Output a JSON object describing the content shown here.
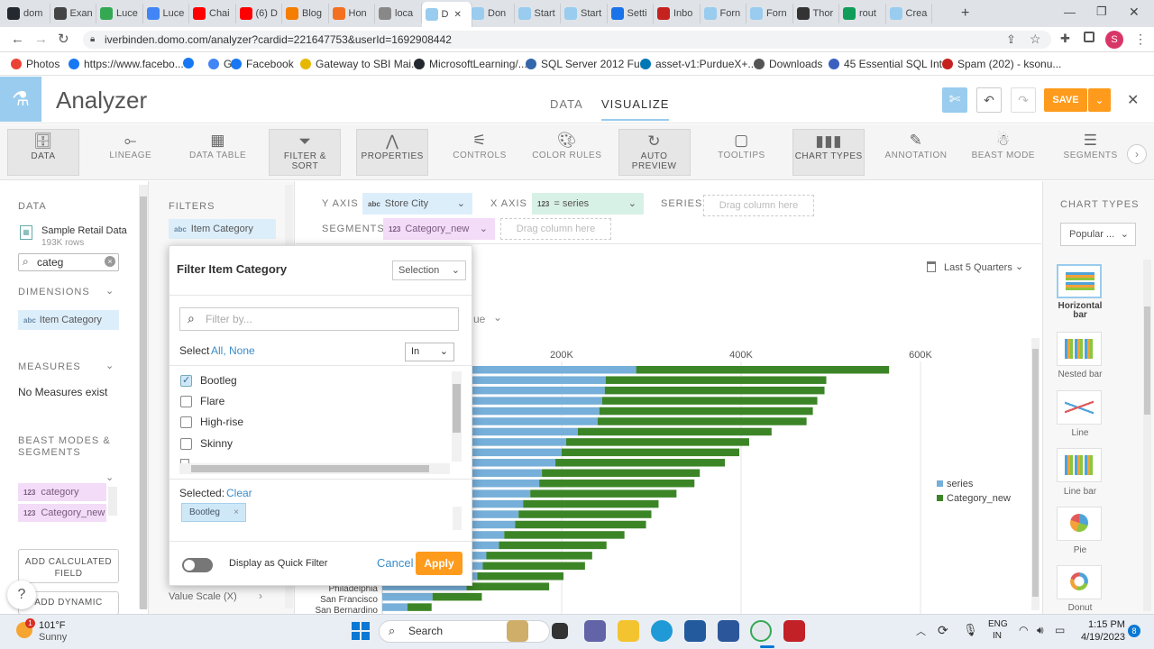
{
  "browser": {
    "tabs": [
      {
        "label": "dom",
        "color": "#24292f"
      },
      {
        "label": "Exan",
        "color": "#444"
      },
      {
        "label": "Luce",
        "color": "#34a853"
      },
      {
        "label": "Luce",
        "color": "#4285f4"
      },
      {
        "label": "Chai",
        "color": "#ff0000"
      },
      {
        "label": "(6) D",
        "color": "#ff0000"
      },
      {
        "label": "Blog",
        "color": "#f57d00"
      },
      {
        "label": "Hon",
        "color": "#f37021"
      },
      {
        "label": "loca",
        "color": "#888"
      },
      {
        "label": "D",
        "color": "#99ccee"
      },
      {
        "label": "Don",
        "color": "#99ccee"
      },
      {
        "label": "Start",
        "color": "#99ccee"
      },
      {
        "label": "Start",
        "color": "#99ccee"
      },
      {
        "label": "Setti",
        "color": "#1a73e8"
      },
      {
        "label": "Inbo",
        "color": "#c5221f"
      },
      {
        "label": "Forn",
        "color": "#99ccee"
      },
      {
        "label": "Forn",
        "color": "#99ccee"
      },
      {
        "label": "Thor",
        "color": "#333"
      },
      {
        "label": "rout",
        "color": "#0f9d58"
      },
      {
        "label": "Crea",
        "color": "#99ccee"
      }
    ],
    "url": "iverbinden.domo.com/analyzer?cardid=221647753&userId=1692908442",
    "bookmarks": [
      {
        "label": "Photos",
        "color": "#ea4335"
      },
      {
        "label": "https://www.facebo...",
        "color": "#1877f2"
      },
      {
        "label": "",
        "color": "#1877f2"
      },
      {
        "label": "G",
        "color": "#4285f4"
      },
      {
        "label": "Facebook",
        "color": "#1877f2"
      },
      {
        "label": "Gateway to SBI Mai...",
        "color": "#e6b800"
      },
      {
        "label": "MicrosoftLearning/...",
        "color": "#24292f"
      },
      {
        "label": "SQL Server 2012 Fu...",
        "color": "#3366aa"
      },
      {
        "label": "asset-v1:PurdueX+...",
        "color": "#0077b5"
      },
      {
        "label": "Downloads",
        "color": "#555"
      },
      {
        "label": "45 Essential SQL Int...",
        "color": "#3b5fc0"
      },
      {
        "label": "Spam (202) - ksonu...",
        "color": "#c5221f"
      }
    ],
    "profile_initial": "S"
  },
  "app": {
    "title": "Analyzer",
    "tabs": [
      "DATA",
      "VISUALIZE"
    ],
    "save_label": "SAVE",
    "toolbar": [
      "DATA",
      "LINEAGE",
      "DATA TABLE",
      "FILTER & SORT",
      "PROPERTIES",
      "CONTROLS",
      "COLOR RULES",
      "AUTO PREVIEW",
      "TOOLTIPS",
      "CHART TYPES",
      "ANNOTATION",
      "BEAST MODE",
      "SEGMENTS"
    ]
  },
  "left": {
    "data_header": "DATA",
    "dataset_name": "Sample Retail Data",
    "dataset_rows": "193K rows",
    "search_value": "categ",
    "dimensions_header": "DIMENSIONS",
    "dimension_item": "Item Category",
    "measures_header": "MEASURES",
    "measures_empty": "No Measures exist",
    "beast_header_1": "BEAST MODES &",
    "beast_header_2": "SEGMENTS",
    "beast_items": [
      "category",
      "Category_new"
    ],
    "add_calc_1": "ADD CALCULATED",
    "add_calc_2": "FIELD",
    "add_dyn": "ADD DYNAMIC"
  },
  "middle": {
    "filters_header": "FILTERS",
    "filter_pill": "Item Category",
    "value_scale": "Value Scale (X)"
  },
  "shelf": {
    "y_axis_label": "Y AXIS",
    "y_axis_value": "Store City",
    "x_axis_label": "X AXIS",
    "x_axis_value": "= series",
    "series_label": "SERIES",
    "series_drop": "Drag column here",
    "segments_label": "SEGMENTS",
    "segments_value": "Category_new",
    "segments_drop": "Drag column here"
  },
  "chart_controls": {
    "date_range": "Last 5 Quarters",
    "partial_label": "ue"
  },
  "chart_data": {
    "type": "bar",
    "orientation": "horizontal",
    "stacked": true,
    "x_ticks": [
      "200K",
      "400K",
      "600K"
    ],
    "xlim": [
      0,
      600000
    ],
    "visible_categories": [
      "Philadelphia",
      "San Francisco",
      "San Bernardino"
    ],
    "series": [
      {
        "name": "series",
        "color": "#76afd9"
      },
      {
        "name": "Category_new",
        "color": "#3c8527"
      }
    ],
    "bars": [
      [
        283000,
        282000
      ],
      [
        249000,
        246000
      ],
      [
        248000,
        245000
      ],
      [
        245000,
        240000
      ],
      [
        242000,
        238000
      ],
      [
        240000,
        233000
      ],
      [
        218000,
        216000
      ],
      [
        205000,
        204000
      ],
      [
        200000,
        198000
      ],
      [
        193000,
        189000
      ],
      [
        178000,
        176000
      ],
      [
        175000,
        173000
      ],
      [
        165000,
        163000
      ],
      [
        157000,
        151000
      ],
      [
        152000,
        148000
      ],
      [
        148000,
        146000
      ],
      [
        136000,
        134000
      ],
      [
        130000,
        120000
      ],
      [
        116000,
        118000
      ],
      [
        112000,
        114000
      ],
      [
        106000,
        96000
      ],
      [
        94000,
        92000
      ],
      [
        56000,
        55000
      ],
      [
        28000,
        27000
      ]
    ],
    "legend_position": "right"
  },
  "right": {
    "header": "CHART TYPES",
    "dropdown": "Popular ...",
    "types": [
      "Horizontal bar",
      "Nested bar",
      "Line",
      "Line bar",
      "Pie",
      "Donut"
    ]
  },
  "modal": {
    "title": "Filter Item Category",
    "mode": "Selection",
    "search_placeholder": "Filter by...",
    "select_prefix": "Select",
    "select_all": "All,",
    "select_none": "None",
    "operator": "In",
    "options": [
      {
        "label": "Bootleg",
        "checked": true
      },
      {
        "label": "Flare",
        "checked": false
      },
      {
        "label": "High-rise",
        "checked": false
      },
      {
        "label": "Skinny",
        "checked": false
      }
    ],
    "selected_label": "Selected:",
    "clear_label": "Clear",
    "selected_chip": "Bootleg",
    "quick_filter_label": "Display as Quick Filter",
    "cancel_label": "Cancel",
    "apply_label": "Apply"
  },
  "taskbar": {
    "weather_temp": "101°F",
    "weather_desc": "Sunny",
    "search_label": "Search",
    "lang_1": "ENG",
    "lang_2": "IN",
    "time": "1:15 PM",
    "date": "4/19/2023",
    "notif_count": "8",
    "badge": "1"
  }
}
